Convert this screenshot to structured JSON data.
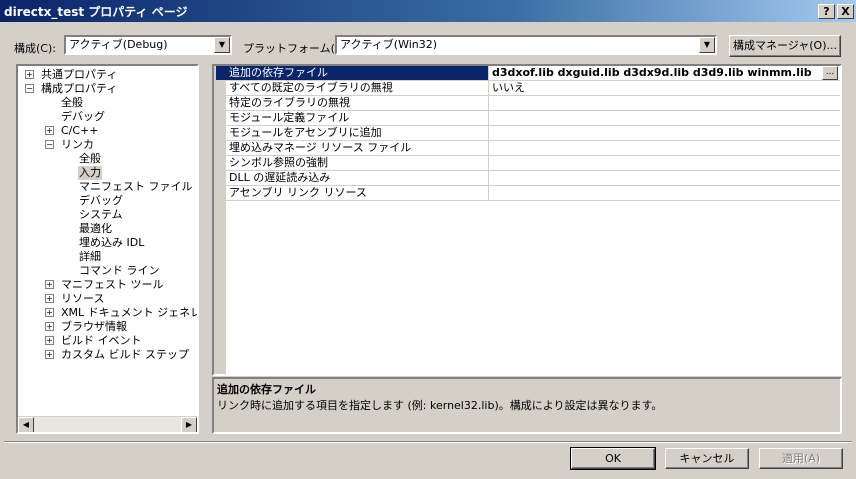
{
  "window": {
    "title": "directx_test プロパティ ページ",
    "help_label": "?",
    "close_label": "X"
  },
  "config": {
    "label": "構成(C):",
    "value": "アクティブ(Debug)"
  },
  "platform": {
    "label": "プラットフォーム(P):",
    "value": "アクティブ(Win32)"
  },
  "config_manager_label": "構成マネージャ(O)...",
  "tree": {
    "items": [
      {
        "label": "共通プロパティ",
        "expander": "+"
      },
      {
        "label": "構成プロパティ",
        "expander": "−"
      },
      {
        "label": "全般",
        "expander": ""
      },
      {
        "label": "デバッグ",
        "expander": ""
      },
      {
        "label": "C/C++",
        "expander": "+"
      },
      {
        "label": "リンカ",
        "expander": "−"
      },
      {
        "label": "全般",
        "expander": ""
      },
      {
        "label": "入力",
        "expander": ""
      },
      {
        "label": "マニフェスト ファイル",
        "expander": ""
      },
      {
        "label": "デバッグ",
        "expander": ""
      },
      {
        "label": "システム",
        "expander": ""
      },
      {
        "label": "最適化",
        "expander": ""
      },
      {
        "label": "埋め込み IDL",
        "expander": ""
      },
      {
        "label": "詳細",
        "expander": ""
      },
      {
        "label": "コマンド ライン",
        "expander": ""
      },
      {
        "label": "マニフェスト ツール",
        "expander": "+"
      },
      {
        "label": "リソース",
        "expander": "+"
      },
      {
        "label": "XML ドキュメント ジェネレータ",
        "expander": "+"
      },
      {
        "label": "ブラウザ情報",
        "expander": "+"
      },
      {
        "label": "ビルド イベント",
        "expander": "+"
      },
      {
        "label": "カスタム ビルド ステップ",
        "expander": "+"
      }
    ]
  },
  "grid": {
    "rows": [
      {
        "key": "追加の依存ファイル",
        "value": "d3dxof.lib dxguid.lib d3dx9d.lib d3d9.lib winmm.lib"
      },
      {
        "key": "すべての既定のライブラリの無視",
        "value": "いいえ"
      },
      {
        "key": "特定のライブラリの無視",
        "value": ""
      },
      {
        "key": "モジュール定義ファイル",
        "value": ""
      },
      {
        "key": "モジュールをアセンブリに追加",
        "value": ""
      },
      {
        "key": "埋め込みマネージ リソース ファイル",
        "value": ""
      },
      {
        "key": "シンボル参照の強制",
        "value": ""
      },
      {
        "key": "DLL の遅延読み込み",
        "value": ""
      },
      {
        "key": "アセンブリ リンク リソース",
        "value": ""
      }
    ],
    "ellipsis_label": "..."
  },
  "description": {
    "title": "追加の依存ファイル",
    "text": "リンク時に追加する項目を指定します (例: kernel32.lib)。構成により設定は異なります。"
  },
  "buttons": {
    "ok": "OK",
    "cancel": "キャンセル",
    "apply": "適用(A)"
  }
}
